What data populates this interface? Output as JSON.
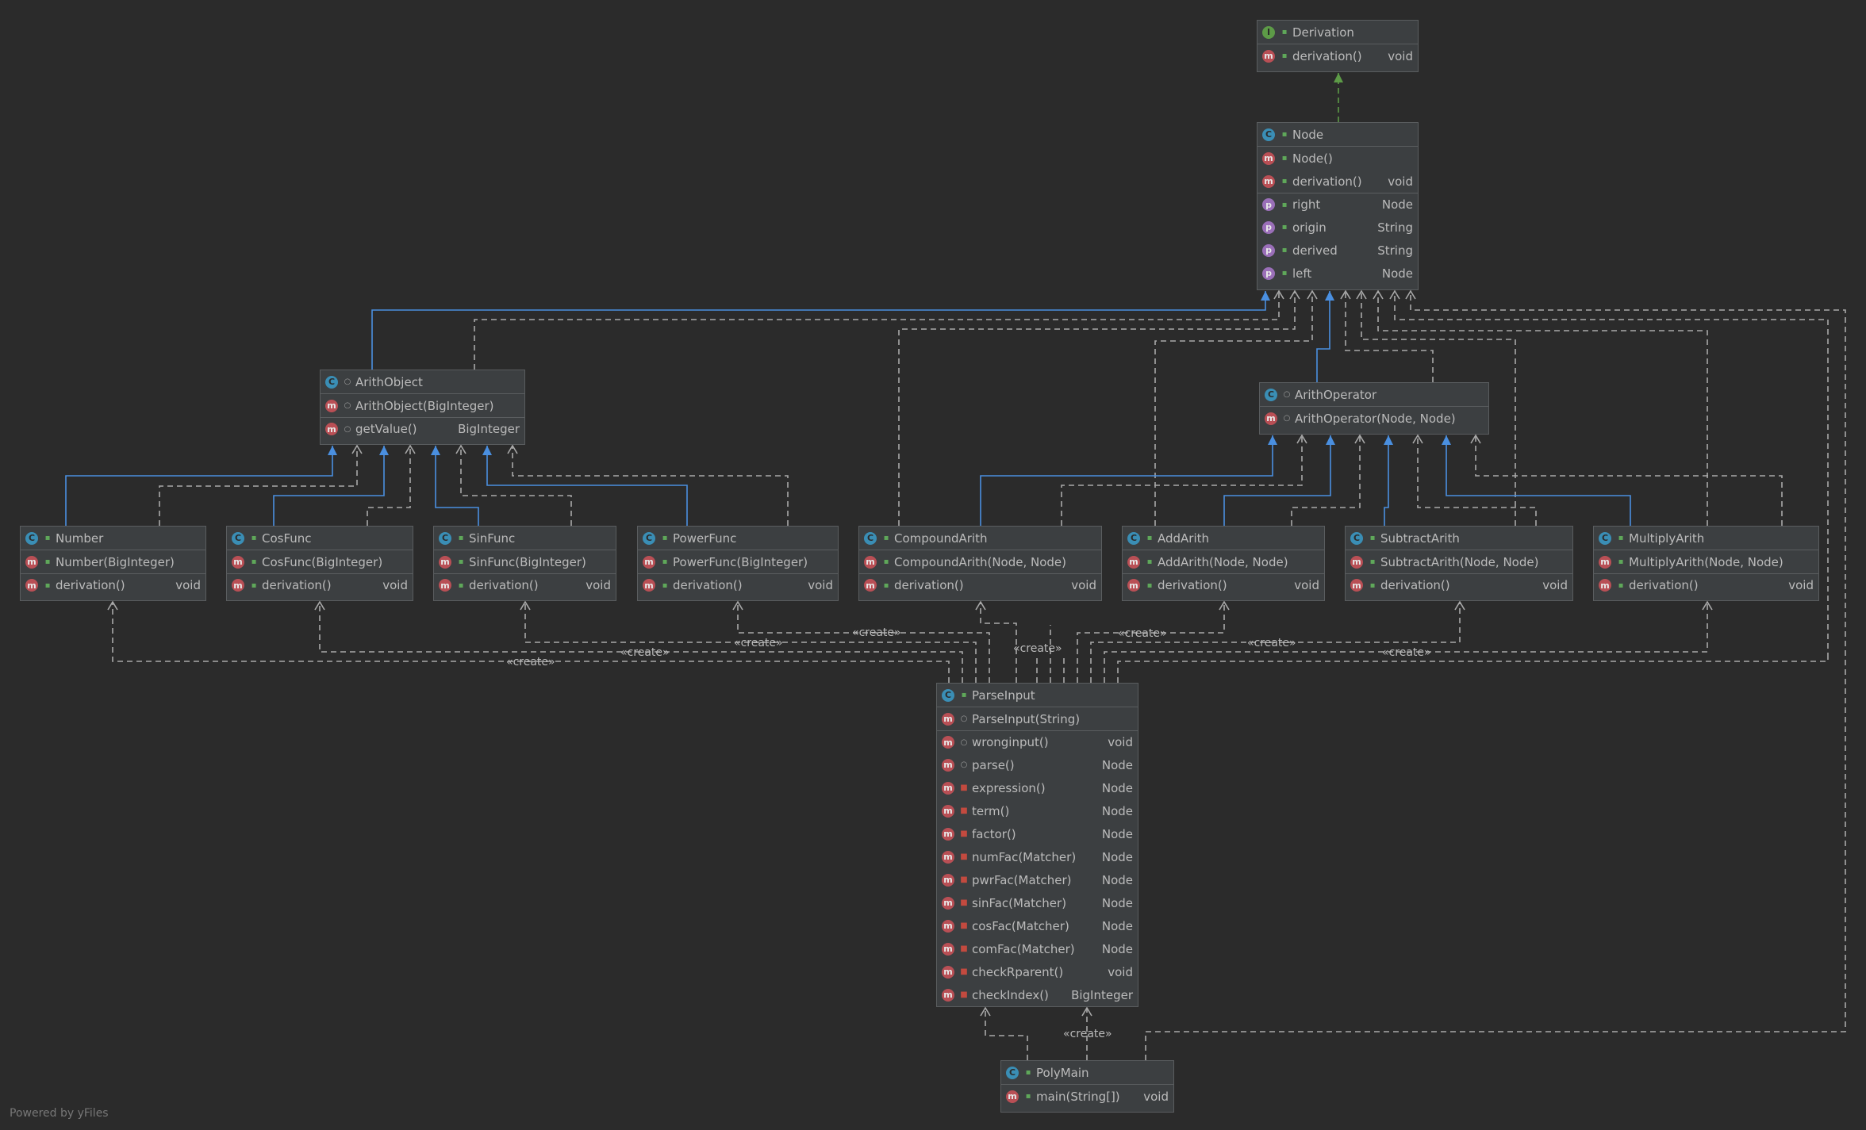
{
  "colors": {
    "background": "#2b2b2b",
    "box": "#3c3f41",
    "border": "#5a5d5f",
    "extends": "#4a8fe0",
    "implements": "#5d9b47",
    "dependency": "#a9a9a9"
  },
  "boxes": {
    "derivation": {
      "title": "Derivation",
      "kind": "I",
      "rows": [
        {
          "kind": "m",
          "name": "derivation()",
          "type": "void"
        }
      ]
    },
    "node": {
      "title": "Node",
      "kind": "C",
      "rows": [
        {
          "kind": "m",
          "name": "Node()",
          "type": ""
        },
        {
          "kind": "m",
          "name": "derivation()",
          "type": "void"
        },
        {
          "kind": "p",
          "name": "right",
          "type": "Node",
          "sep": true
        },
        {
          "kind": "p",
          "name": "origin",
          "type": "String"
        },
        {
          "kind": "p",
          "name": "derived",
          "type": "String"
        },
        {
          "kind": "p",
          "name": "left",
          "type": "Node"
        }
      ]
    },
    "arithobject": {
      "title": "ArithObject",
      "kind": "C",
      "rows": [
        {
          "kind": "m",
          "name": "ArithObject(BigInteger)",
          "type": ""
        },
        {
          "kind": "m",
          "name": "getValue()",
          "type": "BigInteger",
          "sep": true
        }
      ]
    },
    "arithoperator": {
      "title": "ArithOperator",
      "kind": "C",
      "rows": [
        {
          "kind": "m",
          "name": "ArithOperator(Node, Node)",
          "type": ""
        }
      ]
    },
    "number": {
      "title": "Number",
      "kind": "C",
      "rows": [
        {
          "kind": "m",
          "name": "Number(BigInteger)",
          "type": ""
        },
        {
          "kind": "m",
          "name": "derivation()",
          "type": "void",
          "sep": true
        }
      ]
    },
    "cosfunc": {
      "title": "CosFunc",
      "kind": "C",
      "rows": [
        {
          "kind": "m",
          "name": "CosFunc(BigInteger)",
          "type": ""
        },
        {
          "kind": "m",
          "name": "derivation()",
          "type": "void",
          "sep": true
        }
      ]
    },
    "sinfunc": {
      "title": "SinFunc",
      "kind": "C",
      "rows": [
        {
          "kind": "m",
          "name": "SinFunc(BigInteger)",
          "type": ""
        },
        {
          "kind": "m",
          "name": "derivation()",
          "type": "void",
          "sep": true
        }
      ]
    },
    "powerfunc": {
      "title": "PowerFunc",
      "kind": "C",
      "rows": [
        {
          "kind": "m",
          "name": "PowerFunc(BigInteger)",
          "type": ""
        },
        {
          "kind": "m",
          "name": "derivation()",
          "type": "void",
          "sep": true
        }
      ]
    },
    "compoundarith": {
      "title": "CompoundArith",
      "kind": "C",
      "rows": [
        {
          "kind": "m",
          "name": "CompoundArith(Node, Node)",
          "type": ""
        },
        {
          "kind": "m",
          "name": "derivation()",
          "type": "void",
          "sep": true
        }
      ]
    },
    "addarith": {
      "title": "AddArith",
      "kind": "C",
      "rows": [
        {
          "kind": "m",
          "name": "AddArith(Node, Node)",
          "type": ""
        },
        {
          "kind": "m",
          "name": "derivation()",
          "type": "void",
          "sep": true
        }
      ]
    },
    "subtractarith": {
      "title": "SubtractArith",
      "kind": "C",
      "rows": [
        {
          "kind": "m",
          "name": "SubtractArith(Node, Node)",
          "type": ""
        },
        {
          "kind": "m",
          "name": "derivation()",
          "type": "void",
          "sep": true
        }
      ]
    },
    "multiplyarith": {
      "title": "MultiplyArith",
      "kind": "C",
      "rows": [
        {
          "kind": "m",
          "name": "MultiplyArith(Node, Node)",
          "type": ""
        },
        {
          "kind": "m",
          "name": "derivation()",
          "type": "void",
          "sep": true
        }
      ]
    },
    "parseinput": {
      "title": "ParseInput",
      "kind": "C",
      "rows": [
        {
          "kind": "m",
          "name": "ParseInput(String)",
          "type": ""
        },
        {
          "kind": "m",
          "name": "wronginput()",
          "type": "void",
          "sep": true
        },
        {
          "kind": "m",
          "name": "parse()",
          "type": "Node"
        },
        {
          "kind": "m",
          "name": "expression()",
          "type": "Node"
        },
        {
          "kind": "m",
          "name": "term()",
          "type": "Node"
        },
        {
          "kind": "m",
          "name": "factor()",
          "type": "Node"
        },
        {
          "kind": "m",
          "name": "numFac(Matcher)",
          "type": "Node"
        },
        {
          "kind": "m",
          "name": "pwrFac(Matcher)",
          "type": "Node"
        },
        {
          "kind": "m",
          "name": "sinFac(Matcher)",
          "type": "Node"
        },
        {
          "kind": "m",
          "name": "cosFac(Matcher)",
          "type": "Node"
        },
        {
          "kind": "m",
          "name": "comFac(Matcher)",
          "type": "Node"
        },
        {
          "kind": "m",
          "name": "checkRparent()",
          "type": "void"
        },
        {
          "kind": "m",
          "name": "checkIndex()",
          "type": "BigInteger"
        }
      ]
    },
    "polymain": {
      "title": "PolyMain",
      "kind": "C",
      "rows": [
        {
          "kind": "m",
          "name": "main(String[])",
          "type": "void"
        }
      ]
    }
  },
  "edge_labels": {
    "create": "«create»"
  },
  "footer": "Powered by yFiles"
}
